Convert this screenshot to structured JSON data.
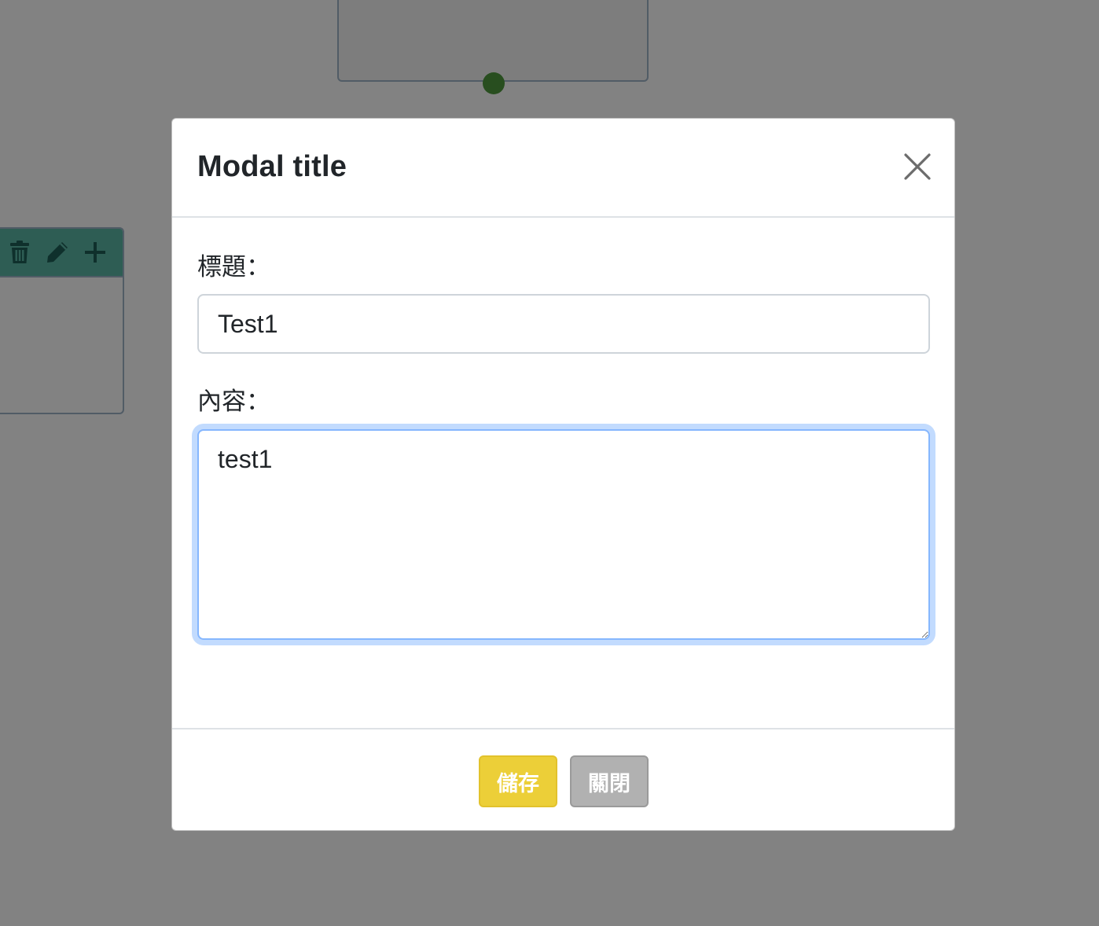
{
  "background": {
    "card_tools": [
      {
        "name": "trash-icon"
      },
      {
        "name": "pencil-icon"
      },
      {
        "name": "plus-icon"
      }
    ]
  },
  "modal": {
    "title": "Modal title",
    "close_icon": "close-icon",
    "fields": {
      "title_label": "標題：",
      "title_value": "Test1",
      "content_label": "內容：",
      "content_value": "test1"
    },
    "footer": {
      "save_label": "儲存",
      "close_label": "關閉"
    }
  },
  "colors": {
    "save_button": "#eccf38",
    "close_button": "#b1b1b1",
    "focus_ring": "#86b7fe",
    "card_header": "#5bb6a6",
    "connector": "#4f9a3e"
  }
}
